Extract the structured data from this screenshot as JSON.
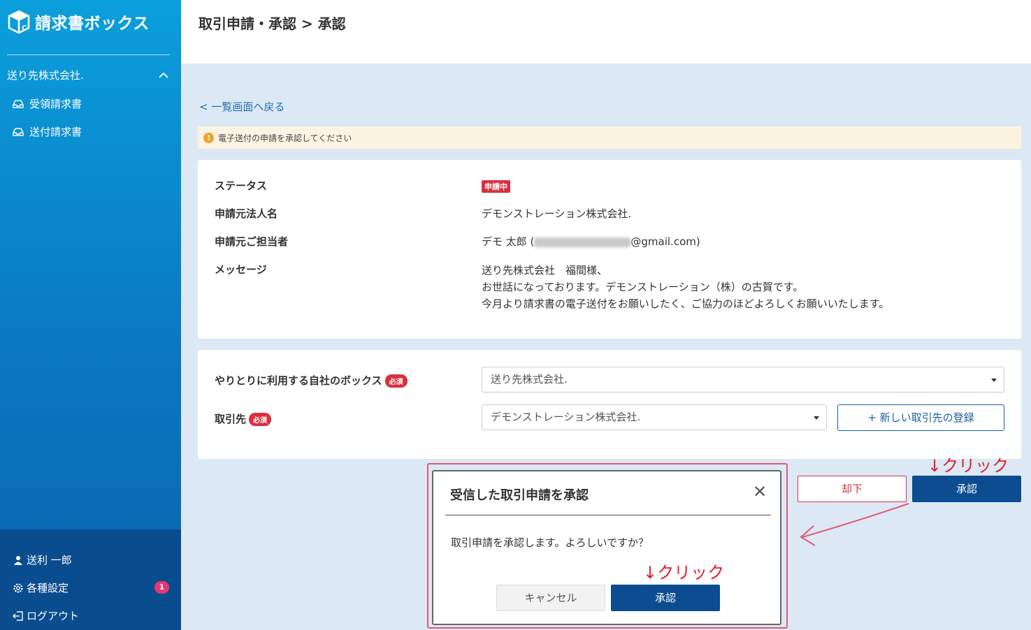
{
  "app": {
    "title": "請求書ボックス"
  },
  "sidebar": {
    "company": "送り先株式会社.",
    "items": [
      {
        "label": "受領請求書"
      },
      {
        "label": "送付請求書"
      }
    ],
    "user": "送利 一郎",
    "settings": "各種設定",
    "settings_badge": "1",
    "logout": "ログアウト"
  },
  "header": {
    "breadcrumb": "取引申請・承認 > 承認"
  },
  "back_link": "< 一覧画面へ戻る",
  "alert": {
    "text": "電子送付の申請を承認してください"
  },
  "details": {
    "status_label": "ステータス",
    "status_value": "申請中",
    "company_label": "申請元法人名",
    "company_value": "デモンストレーション株式会社.",
    "contact_label": "申請元ご担当者",
    "contact_name": "デモ 太郎 (",
    "contact_email_suffix": "@gmail.com)",
    "message_label": "メッセージ",
    "message_lines": [
      "送り先株式会社　福間様、",
      "お世話になっております。デモンストレーション（株）の古賀です。",
      "今月より請求書の電子送付をお願いしたく、ご協力のほどよろしくお願いいたします。"
    ]
  },
  "form": {
    "box_label": "やりとりに利用する自社のボックス",
    "box_value": "送り先株式会社.",
    "partner_label": "取引先",
    "partner_value": "デモンストレーション株式会社.",
    "required": "必須",
    "new_partner_button": "+ 新しい取引先の登録"
  },
  "actions": {
    "reject": "却下",
    "approve": "承認"
  },
  "annotations": {
    "click": "↓クリック"
  },
  "modal": {
    "title": "受信した取引申請を承認",
    "body": "取引申請を承認します。よろしいですか？",
    "cancel": "キャンセル",
    "ok": "承認"
  },
  "colors": {
    "primary": "#0c4d91",
    "danger": "#d9303e",
    "sidebar": "#0a78c2"
  }
}
